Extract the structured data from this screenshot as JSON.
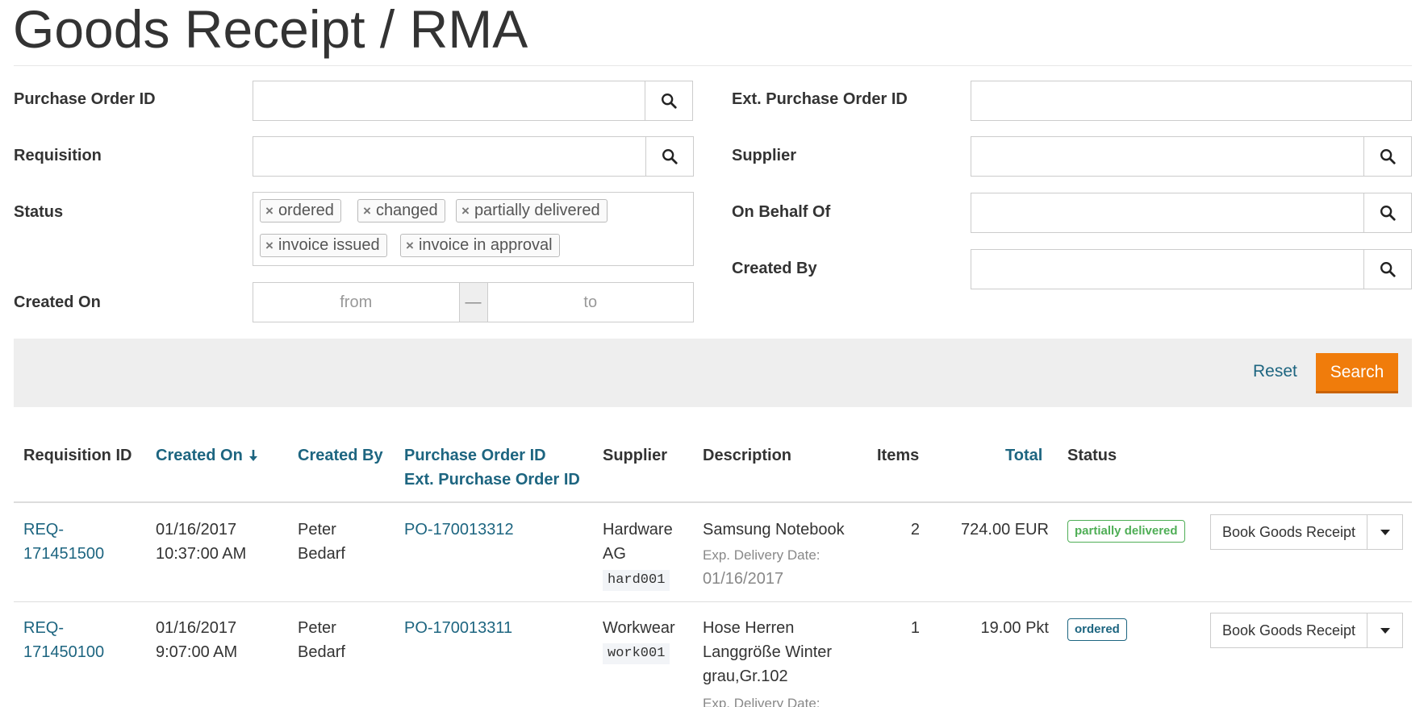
{
  "page": {
    "title": "Goods Receipt / RMA"
  },
  "filters": {
    "purchase_order_id": {
      "label": "Purchase Order ID",
      "value": ""
    },
    "ext_purchase_order_id": {
      "label": "Ext. Purchase Order ID",
      "value": ""
    },
    "requisition": {
      "label": "Requisition",
      "value": ""
    },
    "supplier": {
      "label": "Supplier",
      "value": ""
    },
    "status": {
      "label": "Status",
      "tags": [
        "ordered",
        "changed",
        "partially delivered",
        "invoice issued",
        "invoice in approval"
      ]
    },
    "on_behalf_of": {
      "label": "On Behalf Of",
      "value": ""
    },
    "created_by": {
      "label": "Created By",
      "value": ""
    },
    "created_on": {
      "label": "Created On",
      "from_placeholder": "from",
      "separator": "—",
      "to_placeholder": "to"
    }
  },
  "actions": {
    "reset_label": "Reset",
    "search_label": "Search"
  },
  "table": {
    "headers": {
      "requisition_id": "Requisition ID",
      "created_on": "Created On",
      "created_by": "Created By",
      "purchase_order_id": "Purchase Order ID",
      "ext_purchase_order_id": "Ext. Purchase Order ID",
      "supplier": "Supplier",
      "description": "Description",
      "items": "Items",
      "total": "Total",
      "status": "Status"
    },
    "rows": [
      {
        "req_line1": "REQ-",
        "req_line2": "171451500",
        "date": "01/16/2017",
        "time": "10:37:00 AM",
        "by_line1": "Peter",
        "by_line2": "Bedarf",
        "po": "PO-170013312",
        "supplier_line1": "Hardware",
        "supplier_line2": "AG",
        "supplier_code": "hard001",
        "desc_line1": "Samsung Notebook",
        "exp_label": "Exp. Delivery Date:",
        "exp_date": "01/16/2017",
        "items": "2",
        "total": "724.00 EUR",
        "status": "partially delivered",
        "status_color": "#4fae56",
        "action_label": "Book Goods Receipt"
      },
      {
        "req_line1": "REQ-",
        "req_line2": "171450100",
        "date": "01/16/2017",
        "time": "9:07:00 AM",
        "by_line1": "Peter",
        "by_line2": "Bedarf",
        "po": "PO-170013311",
        "supplier_line1": "Workwear",
        "supplier_code": "work001",
        "desc_line1": "Hose Herren",
        "desc_line2": "Langgröße Winter",
        "desc_line3": "grau,Gr.102",
        "exp_label": "Exp. Delivery Date:",
        "items": "1",
        "total": "19.00 Pkt",
        "status": "ordered",
        "status_color": "#1d6580",
        "action_label": "Book Goods Receipt"
      }
    ]
  },
  "colors": {
    "accent": "#f07c0b",
    "link": "#1d6580",
    "success": "#4fae56"
  },
  "icons": {
    "search": "magnifier-icon",
    "remove": "times-icon",
    "dropdown": "caret-down-icon",
    "sort": "arrow-down-icon"
  }
}
